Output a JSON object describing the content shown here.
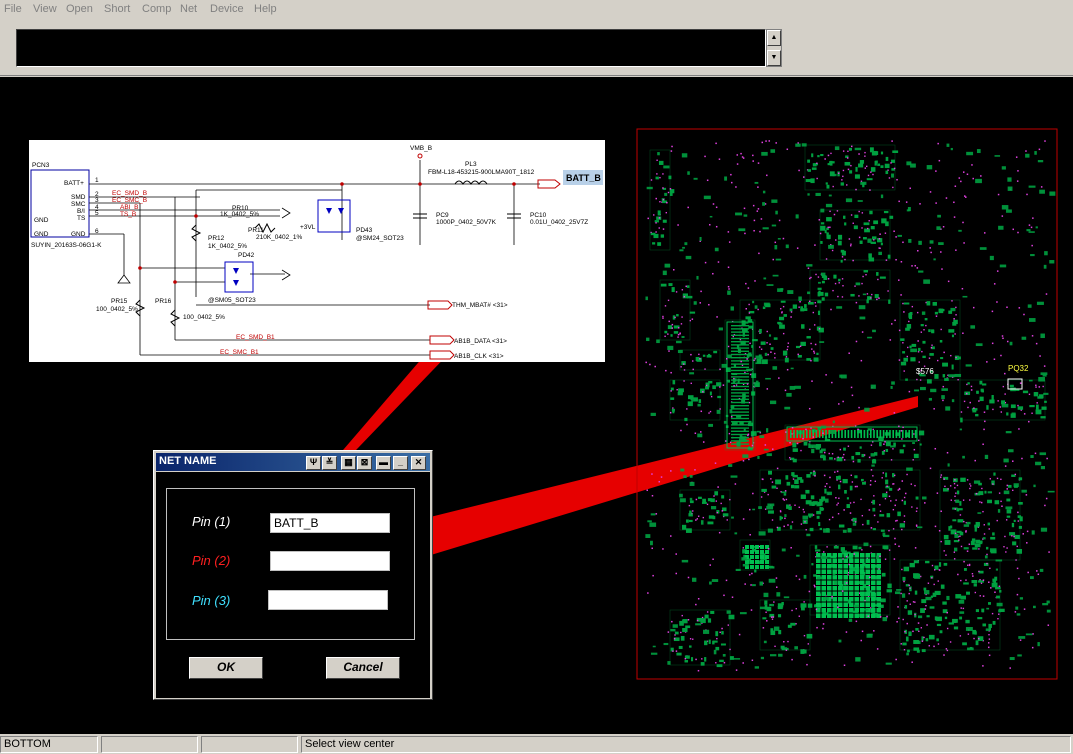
{
  "menu": [
    "File",
    "View",
    "Open",
    "Short",
    "Comp",
    "Net",
    "Device",
    "Help"
  ],
  "statusbar": {
    "layer": "BOTTOM",
    "pane2": "",
    "pane3": "",
    "message": "Select view center"
  },
  "schematic": {
    "connector_ref": "PCN3",
    "connector_part": "SUYIN_20163S-06G1-K",
    "pins_left": [
      "GND",
      "GND"
    ],
    "pins_right": [
      "BATT+",
      "SMD",
      "SMC",
      "B/I",
      "TS",
      "GND"
    ],
    "pin_numbers": [
      "1",
      "2",
      "3",
      "4",
      "5",
      "6"
    ],
    "nets_red": [
      "EC_SMD_B",
      "EC_SMC_B",
      "ABI_B",
      "TS_B",
      "EC_SMD_B1",
      "EC_SMC_B1"
    ],
    "vmb": "VMB_B",
    "inductor_ref": "PL3",
    "inductor_part": "FBM-L18-453215-900LMA90T_1812",
    "batt_net": "BATT_B",
    "pr10_ref": "PR10",
    "pr10_val": "1K_0402_5%",
    "pr11_ref": "PR11",
    "pr11_val": "210K_0402_1%",
    "pr11_net": "+3VL",
    "pr12_ref": "PR12",
    "pr12_val": "1K_0402_5%",
    "pd43_ref": "PD43",
    "pd43_part": "@SM24_SOT23",
    "pc9_ref": "PC9",
    "pc9_val": "1000P_0402_50V7K",
    "pc10_ref": "PC10",
    "pc10_val": "0.01U_0402_25V7Z",
    "pd42_ref": "PD42",
    "pd42_part": "@SM05_SOT23",
    "pr15_ref": "PR15",
    "pr15_val": "100_0402_5%",
    "pr16_ref": "PR16",
    "pr16_val": "100_0402_5%",
    "thm_net": "THM_MBAT# <31>",
    "ab1b_data": "AB1B_DATA <31>",
    "ab1b_clk": "AB1B_CLK <31>"
  },
  "board": {
    "label_576": "$576",
    "label_pq32": "PQ32"
  },
  "dialog": {
    "title": "NET NAME",
    "pins": [
      {
        "label": "Pin (1)",
        "value": "BATT_B",
        "color": "#ffffff"
      },
      {
        "label": "Pin (2)",
        "value": "",
        "color": "#ff2020"
      },
      {
        "label": "Pin (3)",
        "value": "",
        "color": "#40e0ff"
      }
    ],
    "ok_label": "OK",
    "cancel_label": "Cancel"
  },
  "colors": {
    "board_outline": "#c00000",
    "trace": "#00a040",
    "via": "#e040e0",
    "highlight_beam": "#ff0000"
  }
}
